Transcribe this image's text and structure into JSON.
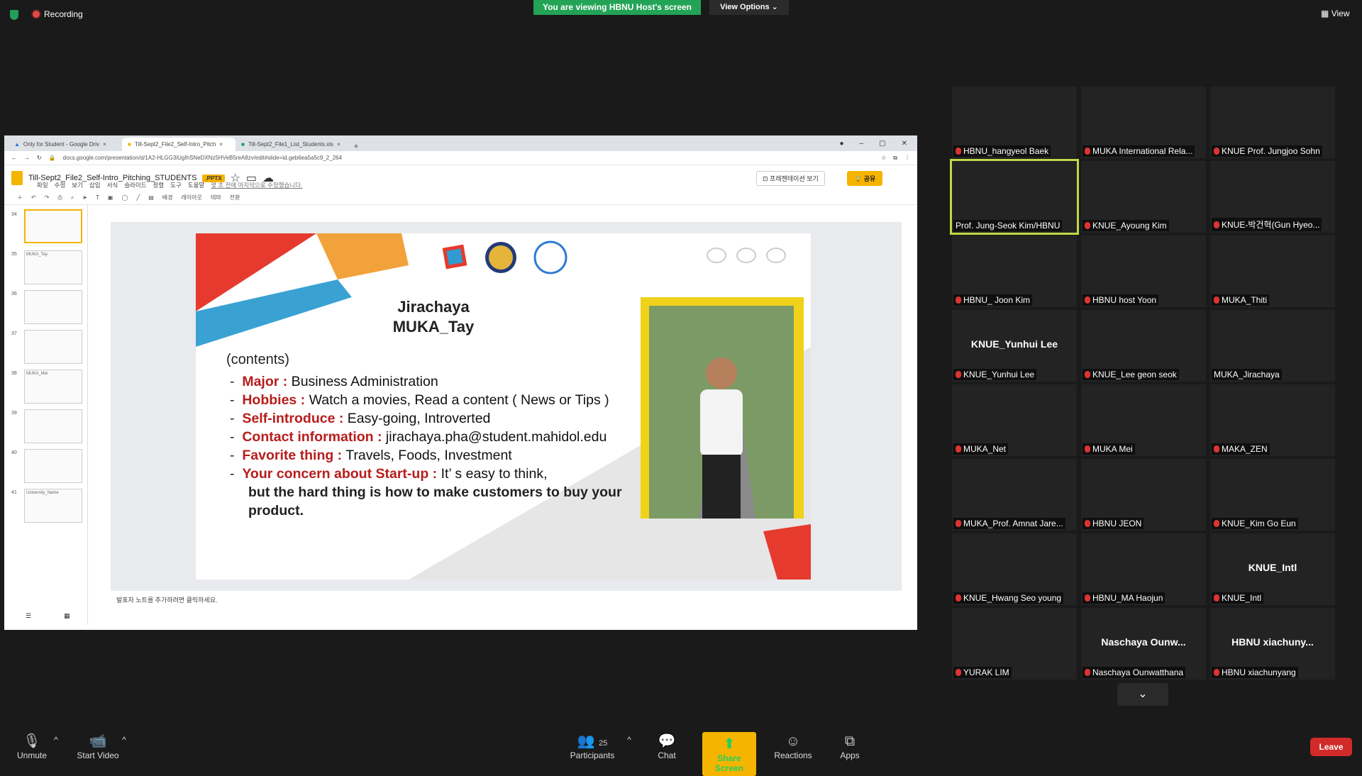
{
  "topbar": {
    "recording": "Recording",
    "viewing_banner": "You are viewing HBNU Host's screen",
    "view_options": "View Options",
    "view": "View"
  },
  "browser": {
    "tabs": [
      {
        "label": "Only for Student - Google Driv"
      },
      {
        "label": "Till-Sept2_File2_Self-Intro_Pitch"
      },
      {
        "label": "Till-Sept2_File1_List_Students.xls"
      }
    ],
    "url": "docs.google.com/presentation/d/1A2-HLGG3iUgIhSNeDXNz5HVeB5reA8zv/edit#slide=id.geb6ea5a5c9_2_264",
    "doc_title": "Till-Sept2_File2_Self-Intro_Pitching_STUDENTS",
    "badge": ".PPTX",
    "menus": [
      "파일",
      "수정",
      "보기",
      "삽입",
      "서식",
      "슬라이드",
      "정렬",
      "도구",
      "도움말"
    ],
    "last_edit": "몇 초 전에 마지막으로 수정했습니다.",
    "present_label": "프레젠테이션 보기",
    "share_label": "공유",
    "toolbar_items": [
      "배경",
      "레이아웃",
      "테마",
      "전환"
    ],
    "thumb_numbers": [
      "34",
      "35",
      "36",
      "37",
      "38",
      "39",
      "40",
      "41"
    ],
    "thumb_texts": [
      "",
      "MUKA_Tay",
      "",
      "",
      "MUKA_Mei",
      "",
      "",
      "University_Name"
    ],
    "notes_placeholder": "발표자 노트를 추가하려면 클릭하세요."
  },
  "slide": {
    "name": "Jirachaya",
    "subname": "MUKA_Tay",
    "contents_heading": "(contents)",
    "bullets": [
      {
        "key": "Major :",
        "value": " Business Administration"
      },
      {
        "key": "Hobbies :",
        "value": " Watch a movies, Read a content ( News or Tips )"
      },
      {
        "key": "Self-introduce :",
        "value": " Easy-going, Introverted"
      },
      {
        "key": "Contact information :",
        "value": " jirachaya.pha@student.mahidol.edu"
      },
      {
        "key": "Favorite thing :",
        "value": " Travels, Foods, Investment"
      },
      {
        "key": "Your concern about Start-up :",
        "value": " It’ s easy to think,"
      }
    ],
    "bullet_cont_1": "but the hard thing is how to make customers to buy your",
    "bullet_cont_2": "product."
  },
  "participants": [
    {
      "name": "HBNU_hangyeol Baek"
    },
    {
      "name": "MUKA International Rela..."
    },
    {
      "name": "KNUE Prof. Jungjoo Sohn"
    },
    {
      "name": "Prof. Jung-Seok Kim/HBNU"
    },
    {
      "name": "KNUE_Ayoung Kim"
    },
    {
      "name": "KNUE-박건혁(Gun Hyeo..."
    },
    {
      "name": "HBNU_ Joon Kim"
    },
    {
      "name": "HBNU host Yoon"
    },
    {
      "name": "MUKA_Thiti"
    },
    {
      "name": "KNUE_Yunhui Lee",
      "big": "KNUE_Yunhui Lee"
    },
    {
      "name": "KNUE_Lee geon seok"
    },
    {
      "name": "MUKA_Jirachaya"
    },
    {
      "name": "MUKA_Net"
    },
    {
      "name": "MUKA  Mei"
    },
    {
      "name": "MAKA_ZEN"
    },
    {
      "name": "MUKA_Prof. Amnat Jare..."
    },
    {
      "name": "HBNU JEON"
    },
    {
      "name": "KNUE_Kim Go Eun"
    },
    {
      "name": "KNUE_Hwang Seo young"
    },
    {
      "name": "HBNU_MA Haojun"
    },
    {
      "name": "KNUE_Intl",
      "big": "KNUE_Intl"
    },
    {
      "name": "YURAK LIM"
    },
    {
      "name": "Naschaya Ounwatthana",
      "big": "Naschaya  Ounw..."
    },
    {
      "name": "HBNU xiachunyang",
      "big": "HBNU  xiachuny..."
    }
  ],
  "bottombar": {
    "unmute": "Unmute",
    "start_video": "Start Video",
    "participants": "Participants",
    "participant_count": "25",
    "chat": "Chat",
    "share_screen": "Share Screen",
    "reactions": "Reactions",
    "apps": "Apps",
    "leave": "Leave"
  },
  "colors": {
    "accent_green": "#23a356",
    "leave_red": "#d22a2a",
    "slides_yellow": "#f4b400",
    "slide_red": "#b81d1d"
  }
}
